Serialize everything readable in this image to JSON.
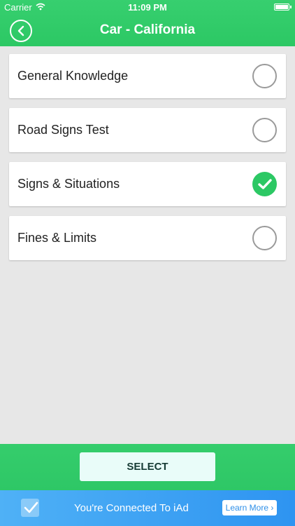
{
  "status_bar": {
    "carrier": "Carrier",
    "time": "11:09 PM"
  },
  "header": {
    "title": "Car - California"
  },
  "options": [
    {
      "label": "General Knowledge",
      "selected": false
    },
    {
      "label": "Road Signs Test",
      "selected": false
    },
    {
      "label": "Signs & Situations",
      "selected": true
    },
    {
      "label": "Fines & Limits",
      "selected": false
    }
  ],
  "footer": {
    "select_label": "SELECT"
  },
  "ad": {
    "text": "You're Connected To iAd",
    "learn_more": "Learn More",
    "chevron": "›"
  },
  "colors": {
    "accent_green": "#2cc864",
    "select_text": "#163b35",
    "ad_blue": "#2e94f1"
  }
}
